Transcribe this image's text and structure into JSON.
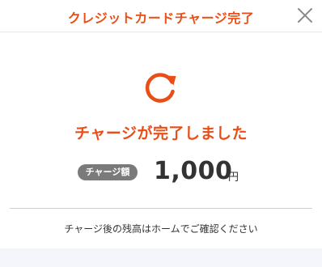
{
  "header": {
    "title": "クレジットカードチャージ完了",
    "close_icon": "close-icon"
  },
  "status": {
    "icon": "refresh-icon",
    "title": "チャージが完了しました"
  },
  "amount": {
    "badge_label": "チャージ額",
    "value": "1,000",
    "unit": "円"
  },
  "note": "チャージ後の残高はホームでご確認ください",
  "colors": {
    "accent": "#ea4e16",
    "badge_bg": "#7a7a7a",
    "text": "#333333",
    "footer_bg": "#f4f6fb"
  }
}
